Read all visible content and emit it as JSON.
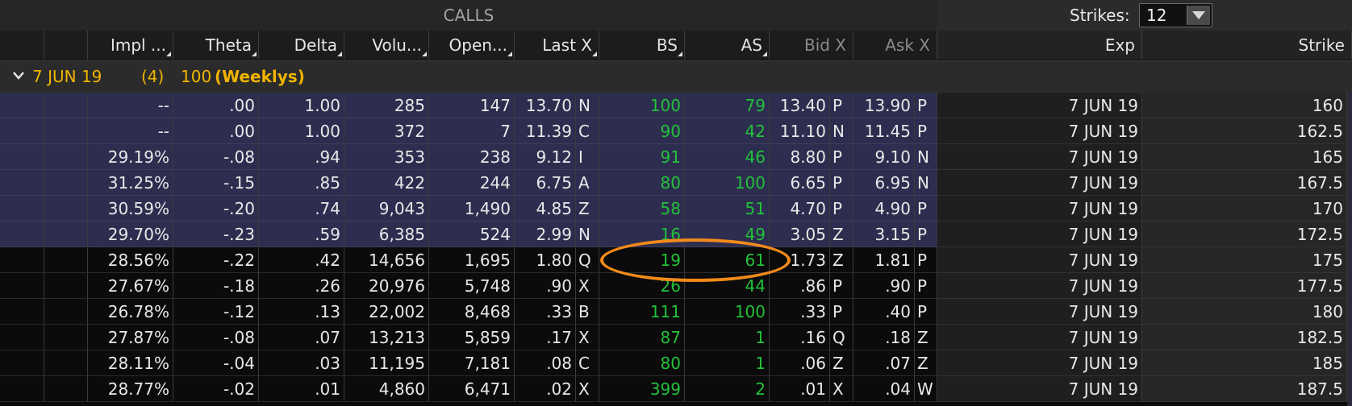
{
  "header": {
    "calls_label": "CALLS",
    "strikes_label": "Strikes:",
    "strikes_value": "12"
  },
  "columns": [
    "Impl ...",
    "Theta",
    "Delta",
    "Volu...",
    "Open...",
    "Last X",
    "BS",
    "AS",
    "Bid X",
    "Ask X",
    "Exp",
    "Strike"
  ],
  "group": {
    "date": "7 JUN 19",
    "count": "(4)",
    "multiplier": "100",
    "type": "(Weeklys)"
  },
  "rows": [
    {
      "iv": "--",
      "theta": ".00",
      "delta": "1.00",
      "vol": "285",
      "oi": "147",
      "last": "13.70",
      "lx": "N",
      "bs": "100",
      "as": "79",
      "bid": "13.40",
      "bx": "P",
      "ask": "13.90",
      "ax": "P",
      "exp": "7 JUN 19",
      "strike": "160"
    },
    {
      "iv": "--",
      "theta": ".00",
      "delta": "1.00",
      "vol": "372",
      "oi": "7",
      "last": "11.39",
      "lx": "C",
      "bs": "90",
      "as": "42",
      "bid": "11.10",
      "bx": "N",
      "ask": "11.45",
      "ax": "P",
      "exp": "7 JUN 19",
      "strike": "162.5"
    },
    {
      "iv": "29.19%",
      "theta": "-.08",
      "delta": ".94",
      "vol": "353",
      "oi": "238",
      "last": "9.12",
      "lx": "I",
      "bs": "91",
      "as": "46",
      "bid": "8.80",
      "bx": "P",
      "ask": "9.10",
      "ax": "N",
      "exp": "7 JUN 19",
      "strike": "165"
    },
    {
      "iv": "31.25%",
      "theta": "-.15",
      "delta": ".85",
      "vol": "422",
      "oi": "244",
      "last": "6.75",
      "lx": "A",
      "bs": "80",
      "as": "100",
      "bid": "6.65",
      "bx": "P",
      "ask": "6.95",
      "ax": "N",
      "exp": "7 JUN 19",
      "strike": "167.5"
    },
    {
      "iv": "30.59%",
      "theta": "-.20",
      "delta": ".74",
      "vol": "9,043",
      "oi": "1,490",
      "last": "4.85",
      "lx": "Z",
      "bs": "58",
      "as": "51",
      "bid": "4.70",
      "bx": "P",
      "ask": "4.90",
      "ax": "P",
      "exp": "7 JUN 19",
      "strike": "170"
    },
    {
      "iv": "29.70%",
      "theta": "-.23",
      "delta": ".59",
      "vol": "6,385",
      "oi": "524",
      "last": "2.99",
      "lx": "N",
      "bs": "16",
      "as": "49",
      "bid": "3.05",
      "bx": "Z",
      "ask": "3.15",
      "ax": "P",
      "exp": "7 JUN 19",
      "strike": "172.5"
    },
    {
      "iv": "28.56%",
      "theta": "-.22",
      "delta": ".42",
      "vol": "14,656",
      "oi": "1,695",
      "last": "1.80",
      "lx": "Q",
      "bs": "19",
      "as": "61",
      "bid": "1.73",
      "bx": "Z",
      "ask": "1.81",
      "ax": "P",
      "exp": "7 JUN 19",
      "strike": "175"
    },
    {
      "iv": "27.67%",
      "theta": "-.18",
      "delta": ".26",
      "vol": "20,976",
      "oi": "5,748",
      "last": ".90",
      "lx": "X",
      "bs": "26",
      "as": "44",
      "bid": ".86",
      "bx": "P",
      "ask": ".90",
      "ax": "P",
      "exp": "7 JUN 19",
      "strike": "177.5"
    },
    {
      "iv": "26.78%",
      "theta": "-.12",
      "delta": ".13",
      "vol": "22,002",
      "oi": "8,468",
      "last": ".33",
      "lx": "B",
      "bs": "111",
      "as": "100",
      "bid": ".33",
      "bx": "P",
      "ask": ".40",
      "ax": "P",
      "exp": "7 JUN 19",
      "strike": "180"
    },
    {
      "iv": "27.87%",
      "theta": "-.08",
      "delta": ".07",
      "vol": "13,213",
      "oi": "5,859",
      "last": ".17",
      "lx": "X",
      "bs": "87",
      "as": "1",
      "bid": ".16",
      "bx": "Q",
      "ask": ".18",
      "ax": "Z",
      "exp": "7 JUN 19",
      "strike": "182.5"
    },
    {
      "iv": "28.11%",
      "theta": "-.04",
      "delta": ".03",
      "vol": "11,195",
      "oi": "7,181",
      "last": ".08",
      "lx": "C",
      "bs": "80",
      "as": "1",
      "bid": ".06",
      "bx": "Z",
      "ask": ".07",
      "ax": "Z",
      "exp": "7 JUN 19",
      "strike": "185"
    },
    {
      "iv": "28.77%",
      "theta": "-.02",
      "delta": ".01",
      "vol": "4,860",
      "oi": "6,471",
      "last": ".02",
      "lx": "X",
      "bs": "399",
      "as": "2",
      "bid": ".01",
      "bx": "X",
      "ask": ".04",
      "ax": "W",
      "exp": "7 JUN 19",
      "strike": "187.5"
    }
  ],
  "colors": {
    "itm_row": "#2d2d4f",
    "size_green": "#22c13a",
    "group_gold": "#f0b400",
    "highlight": "#f28a1a"
  },
  "icons": {
    "group_toggle": "chevron-down-icon",
    "strikes_dropdown": "dropdown-triangle-icon",
    "sort_marker": "sort-triangle-icon"
  }
}
